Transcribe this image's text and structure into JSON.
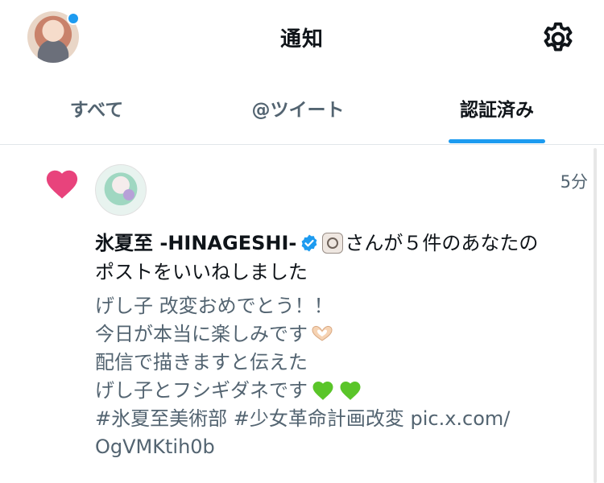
{
  "header": {
    "title": "通知"
  },
  "tabs": [
    {
      "label": "すべて"
    },
    {
      "label": "@ツイート"
    },
    {
      "label": "認証済み"
    }
  ],
  "notification": {
    "time": "5分",
    "user_name": "氷夏至 -HINAGESHI-",
    "action_part1": "さんが５件のあなたの",
    "action_part2": "ポストをいいねしました",
    "body_lines": [
      "げし子 改変おめでとう！！",
      "今日が本当に楽しみです",
      "配信で描きますと伝えた",
      "げし子とフシギダネです",
      "#氷夏至美術部  #少女革命計画改変 pic.x.com/",
      "OgVMKtih0b"
    ]
  },
  "colors": {
    "accent": "#1d9bf0",
    "like_heart": "#e8437c",
    "green_heart": "#5ac529",
    "muted_text": "#536471"
  },
  "icons": [
    "settings-gear-icon",
    "like-heart-icon",
    "verified-badge-icon",
    "heart-hands-emoji",
    "green-heart-emoji"
  ]
}
